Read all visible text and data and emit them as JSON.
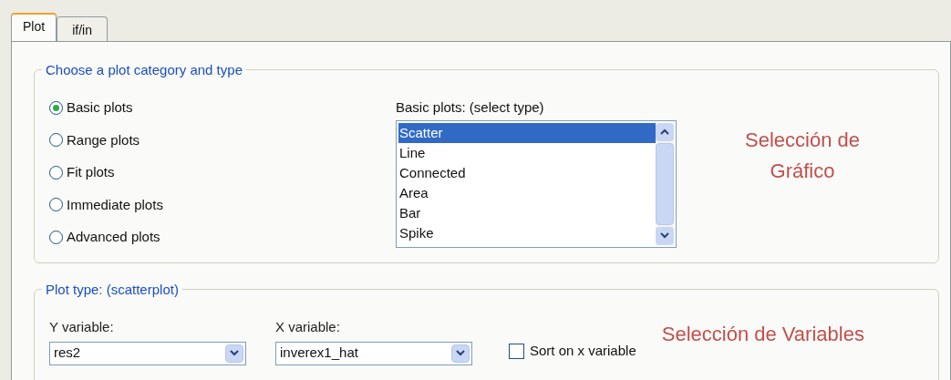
{
  "tabs": [
    {
      "label": "Plot",
      "selected": true
    },
    {
      "label": "if/in",
      "selected": false
    }
  ],
  "category_group": {
    "title": "Choose a plot category and type",
    "radios": [
      {
        "label": "Basic plots",
        "selected": true
      },
      {
        "label": "Range plots",
        "selected": false
      },
      {
        "label": "Fit plots",
        "selected": false
      },
      {
        "label": "Immediate plots",
        "selected": false
      },
      {
        "label": "Advanced plots",
        "selected": false
      }
    ],
    "list_label": "Basic plots: (select type)",
    "list_items": [
      {
        "label": "Scatter",
        "selected": true
      },
      {
        "label": "Line",
        "selected": false
      },
      {
        "label": "Connected",
        "selected": false
      },
      {
        "label": "Area",
        "selected": false
      },
      {
        "label": "Bar",
        "selected": false
      },
      {
        "label": "Spike",
        "selected": false
      }
    ],
    "annotation": "Selección de Gráfico"
  },
  "plot_type_group": {
    "title": "Plot type: (scatterplot)",
    "y_variable": {
      "label": "Y variable:",
      "value": "res2"
    },
    "x_variable": {
      "label": "X variable:",
      "value": "inverex1_hat"
    },
    "sort_checkbox": {
      "label": "Sort on x variable",
      "checked": false
    },
    "annotation": "Selección de Variables"
  }
}
